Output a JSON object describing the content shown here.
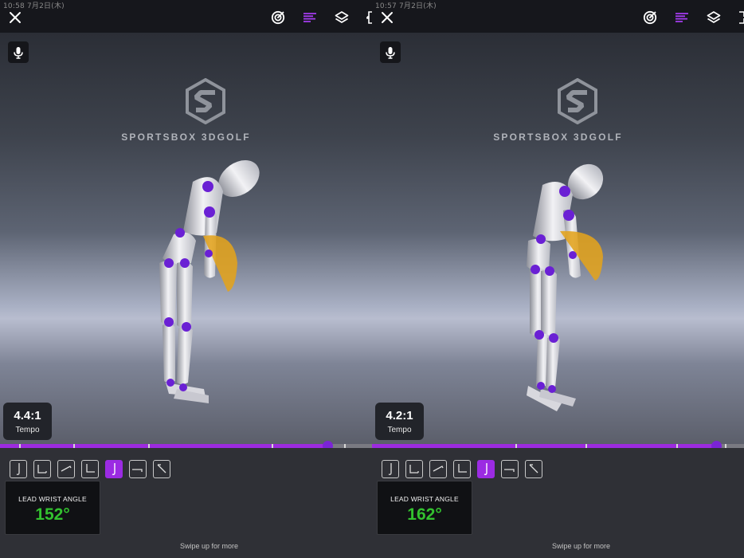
{
  "panes": [
    {
      "status_text": "10:58 7月2日(木)",
      "brand": "SPORTSBOX 3DGOLF",
      "tempo_value": "4.4:1",
      "tempo_label": "Tempo",
      "metric_label": "LEAD WRIST ANGLE",
      "metric_value": "152°",
      "swipe_hint": "Swipe up for more",
      "timeline_progress": 0.88
    },
    {
      "status_text": "10:57 7月2日(木)",
      "brand": "SPORTSBOX 3DGOLF",
      "tempo_value": "4.2:1",
      "tempo_label": "Tempo",
      "metric_label": "LEAD WRIST ANGLE",
      "metric_value": "162°",
      "swipe_hint": "Swipe up for more",
      "timeline_progress": 0.925
    }
  ],
  "icons": {
    "close": "close-icon",
    "target": "target-icon",
    "lines": "text-lines-icon",
    "layers": "layers-icon",
    "expand": "expand-icon",
    "mic": "microphone-icon"
  },
  "position_buttons": [
    "address",
    "takeaway",
    "halfway-back",
    "top",
    "impact",
    "halfway-through",
    "finish"
  ],
  "active_position_index": 4,
  "colors": {
    "accent": "#9b2be3",
    "metric_value": "#33c12f",
    "body_joint": "#6a20d4",
    "club_plane": "#e3a31c"
  }
}
